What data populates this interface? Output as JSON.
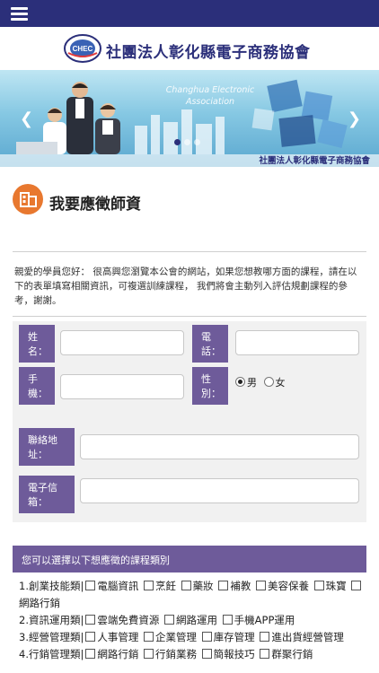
{
  "header": {
    "menu_icon": "hamburger-menu-icon",
    "colors": {
      "nav_bg": "#2b2f7a",
      "accent": "#6e5b9a",
      "title_icon": "#e8782f"
    }
  },
  "logo": {
    "badge_text": "CHEC",
    "org_name": "社團法人彰化縣電子商務協會"
  },
  "banner": {
    "english_line1": "Changhua Electronic",
    "english_line2": "Association",
    "footer_cn": "社團法人彰化縣電子商務協會",
    "prev_icon": "chevron-left-icon",
    "next_icon": "chevron-right-icon"
  },
  "page": {
    "title": "我要應徵師資",
    "title_icon": "building-icon",
    "intro": "親愛的學員您好： 很高興您瀏覽本公會的網站，如果您想教哪方面的課程，請在以下的表單填寫相關資訊，可複選訓練課程， 我們將會主動列入評估規劃課程的參考，謝謝。"
  },
  "form": {
    "name_label": "姓名：",
    "phone_label": "電話：",
    "mobile_label": "手機：",
    "gender_label": "性別：",
    "gender_options": [
      "男",
      "女"
    ],
    "gender_selected": "男",
    "address_label": "聯絡地址：",
    "email_label": "電子信箱："
  },
  "categories": {
    "header": "您可以選擇以下想應徵的課程類別",
    "rows": [
      {
        "label": "1.創業技能類|",
        "items": [
          "電腦資訊",
          "烹飪",
          "藥妝",
          "補教",
          "美容保養",
          "珠寶",
          "網路行銷"
        ]
      },
      {
        "label": "2.資訊運用類|",
        "items": [
          "雲端免費資源",
          "網路運用",
          "手機APP運用"
        ]
      },
      {
        "label": "3.經營管理類|",
        "items": [
          "人事管理",
          "企業管理",
          "庫存管理",
          "進出貨經營管理"
        ]
      },
      {
        "label": "4.行銷管理類|",
        "items": [
          "網路行銷",
          "行銷業務",
          "簡報技巧",
          "群聚行銷"
        ]
      }
    ]
  }
}
